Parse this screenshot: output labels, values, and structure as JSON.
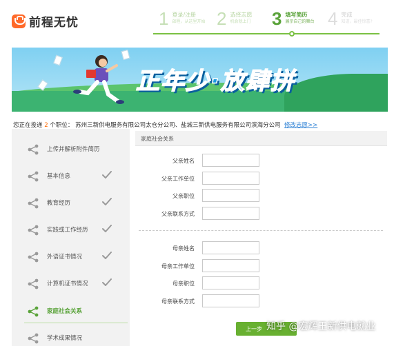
{
  "brand": {
    "name": "前程无忧"
  },
  "steps": [
    {
      "num": "1",
      "title": "登录/注册",
      "sub": "啟程，从这里开始"
    },
    {
      "num": "2",
      "title": "选择志愿",
      "sub": "机会就上门"
    },
    {
      "num": "3",
      "title": "填写简历",
      "sub": "展示自己的舞台"
    },
    {
      "num": "4",
      "title": "完成",
      "sub": "知道，最佳惊喜?"
    }
  ],
  "banner": {
    "slogan": "正年少·放肆拼"
  },
  "notice": {
    "prefix": "您正在投递",
    "count": "2",
    "middle": "个职位：",
    "positions": "苏州三新供电服务有限公司太仓分公司、盐城三新供电服务有限公司滨海分公司",
    "link": "修改志愿>>"
  },
  "sidebar": {
    "items": [
      {
        "label": "上传并解析附件简历",
        "done": false
      },
      {
        "label": "基本信息",
        "done": true
      },
      {
        "label": "教育经历",
        "done": true
      },
      {
        "label": "实践或工作经历",
        "done": true
      },
      {
        "label": "外语证书情况",
        "done": true
      },
      {
        "label": "计算机证书情况",
        "done": true
      },
      {
        "label": "家庭社会关系",
        "done": false,
        "active": true
      },
      {
        "label": "学术成果情况",
        "done": false
      }
    ]
  },
  "panel": {
    "title": "家庭社会关系",
    "father": [
      {
        "label": "父亲姓名",
        "value": ""
      },
      {
        "label": "父亲工作单位",
        "value": ""
      },
      {
        "label": "父亲职位",
        "value": ""
      },
      {
        "label": "父亲联系方式",
        "value": ""
      }
    ],
    "mother": [
      {
        "label": "母亲姓名",
        "value": ""
      },
      {
        "label": "母亲工作单位",
        "value": ""
      },
      {
        "label": "母亲职位",
        "value": ""
      },
      {
        "label": "母亲联系方式",
        "value": ""
      }
    ],
    "next_label": "上一步"
  },
  "watermark": "知乎 @宏辉王新供电就业",
  "colors": {
    "accent": "#5aa33a",
    "brand": "#ff6a2a",
    "link": "#2a7fd4",
    "count": "#ff6a00"
  }
}
